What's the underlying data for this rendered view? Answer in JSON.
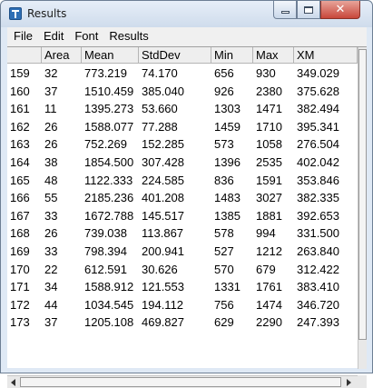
{
  "window": {
    "title": "Results"
  },
  "menu": {
    "items": [
      "File",
      "Edit",
      "Font",
      "Results"
    ]
  },
  "table": {
    "columns": [
      "",
      "Area",
      "Mean",
      "StdDev",
      "Min",
      "Max",
      "XM"
    ],
    "rows": [
      [
        "159",
        "32",
        "773.219",
        "74.170",
        "656",
        "930",
        "349.029"
      ],
      [
        "160",
        "37",
        "1510.459",
        "385.040",
        "926",
        "2380",
        "375.628"
      ],
      [
        "161",
        "11",
        "1395.273",
        "53.660",
        "1303",
        "1471",
        "382.494"
      ],
      [
        "162",
        "26",
        "1588.077",
        "77.288",
        "1459",
        "1710",
        "395.341"
      ],
      [
        "163",
        "26",
        "752.269",
        "152.285",
        "573",
        "1058",
        "276.504"
      ],
      [
        "164",
        "38",
        "1854.500",
        "307.428",
        "1396",
        "2535",
        "402.042"
      ],
      [
        "165",
        "48",
        "1122.333",
        "224.585",
        "836",
        "1591",
        "353.846"
      ],
      [
        "166",
        "55",
        "2185.236",
        "401.208",
        "1483",
        "3027",
        "382.335"
      ],
      [
        "167",
        "33",
        "1672.788",
        "145.517",
        "1385",
        "1881",
        "392.653"
      ],
      [
        "168",
        "26",
        "739.038",
        "113.867",
        "578",
        "994",
        "331.500"
      ],
      [
        "169",
        "33",
        "798.394",
        "200.941",
        "527",
        "1212",
        "263.840"
      ],
      [
        "170",
        "22",
        "612.591",
        "30.626",
        "570",
        "679",
        "312.422"
      ],
      [
        "171",
        "34",
        "1588.912",
        "121.553",
        "1331",
        "1761",
        "383.410"
      ],
      [
        "172",
        "44",
        "1034.545",
        "194.112",
        "756",
        "1474",
        "346.720"
      ],
      [
        "173",
        "37",
        "1205.108",
        "469.827",
        "629",
        "2290",
        "247.393"
      ]
    ]
  }
}
